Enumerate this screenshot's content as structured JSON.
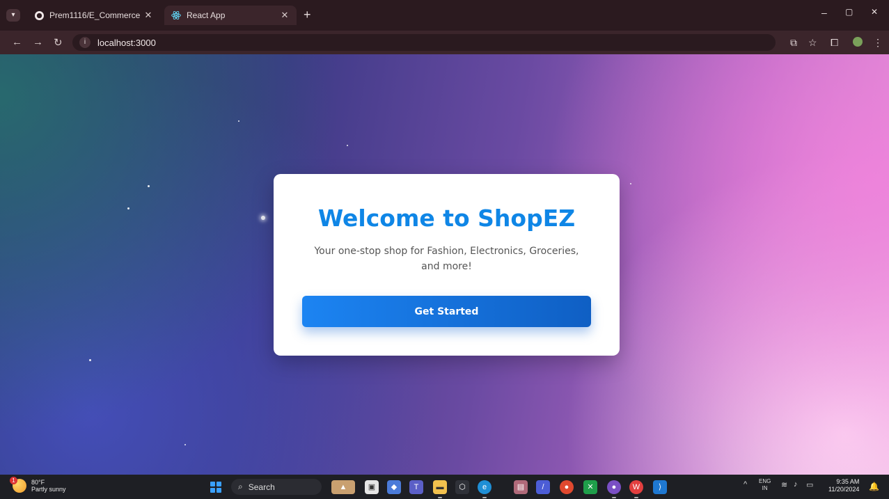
{
  "browser": {
    "tabs": [
      {
        "title": "Prem1116/E_Commerce",
        "active": false,
        "icon": "github-icon"
      },
      {
        "title": "React App",
        "active": true,
        "icon": "react-icon"
      }
    ],
    "new_tab": "+",
    "address": "localhost:3000",
    "controls": {
      "minimize": "–",
      "restore": "▢",
      "close": "✕"
    }
  },
  "page": {
    "title": "Welcome to ShopEZ",
    "subtitle": "Your one-stop shop for Fashion, Electronics, Groceries, and more!",
    "cta": "Get Started",
    "colors": {
      "title": "#0f86e6",
      "button": "#1c84f2"
    }
  },
  "taskbar": {
    "weather": {
      "temp": "80°F",
      "condition": "Partly sunny",
      "badge": "1"
    },
    "search_label": "Search",
    "language": {
      "line1": "ENG",
      "line2": "IN"
    },
    "clock": {
      "time": "9:35 AM",
      "date": "11/20/2024"
    }
  }
}
